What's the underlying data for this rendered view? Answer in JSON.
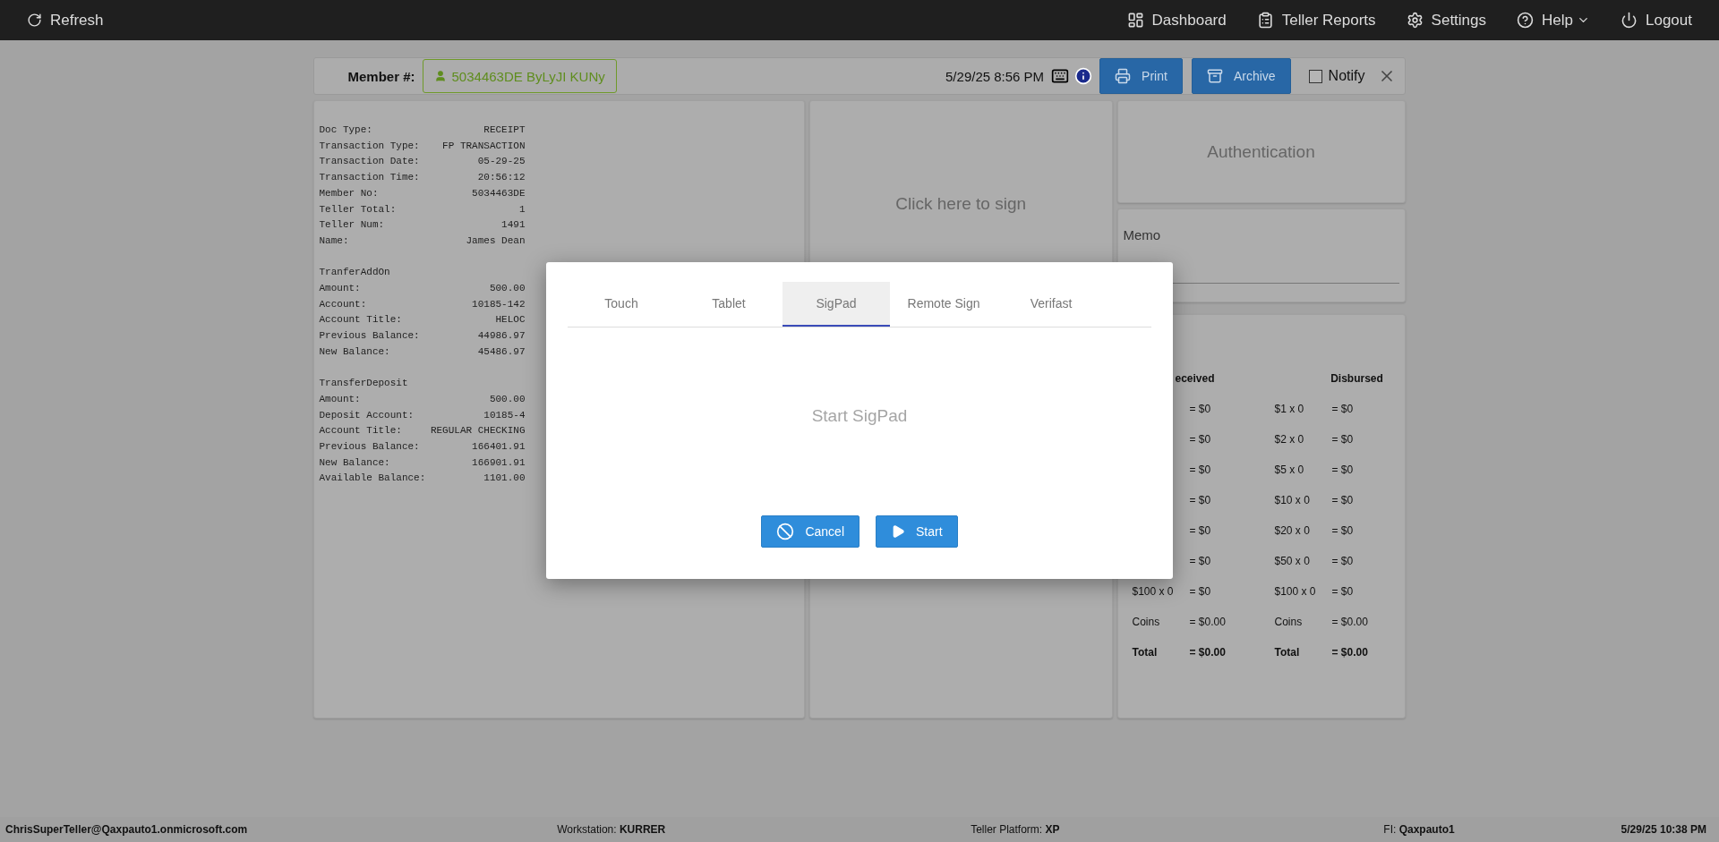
{
  "nav": {
    "left": [
      "Refresh"
    ],
    "right": [
      {
        "label": "Dashboard",
        "dropdown": false
      },
      {
        "label": "Teller Reports",
        "dropdown": false
      },
      {
        "label": "Settings",
        "dropdown": false
      },
      {
        "label": "Help",
        "dropdown": true
      },
      {
        "label": "Logout",
        "dropdown": false
      }
    ]
  },
  "header": {
    "member_label": "Member #:",
    "member": "5034463DE ByLyJI KUNy",
    "datetime": "5/29/25 8:56 PM",
    "buttons": [
      "Print",
      "Archive"
    ],
    "notify": {
      "label": "Notify",
      "checked": false
    }
  },
  "receipt": {
    "sections": [
      {
        "lines": [
          {
            "label": "Doc Type:",
            "value": "RECEIPT"
          },
          {
            "label": "Transaction Type:",
            "value": "FP TRANSACTION"
          },
          {
            "label": "Transaction Date:",
            "value": "05-29-25"
          },
          {
            "label": "Transaction Time:",
            "value": "20:56:12"
          },
          {
            "label": "Member No:",
            "value": "5034463DE"
          },
          {
            "label": "Teller Total:",
            "value": "1"
          },
          {
            "label": "Teller Num:",
            "value": "1491"
          },
          {
            "label": "Name:",
            "value": "James Dean"
          }
        ]
      },
      {
        "title": "TranferAddOn",
        "lines": [
          {
            "label": "Amount:",
            "value": "500.00"
          },
          {
            "label": "Account:",
            "value": "10185-142"
          },
          {
            "label": "Account Title:",
            "value": "HELOC"
          },
          {
            "label": "Previous Balance:",
            "value": "44986.97"
          },
          {
            "label": "New Balance:",
            "value": "45486.97"
          }
        ]
      },
      {
        "title": "TransferDeposit",
        "lines": [
          {
            "label": "Amount:",
            "value": "500.00"
          },
          {
            "label": "Deposit Account:",
            "value": "10185-4"
          },
          {
            "label": "Account Title:",
            "value": "REGULAR CHECKING"
          },
          {
            "label": "Previous Balance:",
            "value": "166401.91"
          },
          {
            "label": "New Balance:",
            "value": "166901.91"
          },
          {
            "label": "Available Balance:",
            "value": "1101.00"
          }
        ]
      }
    ]
  },
  "signature": {
    "prompt": "Click here to sign"
  },
  "authentication": {
    "title": "Authentication"
  },
  "memo": {
    "label": "Memo"
  },
  "cash": {
    "received": {
      "heading": "eceived",
      "rows": [
        {
          "kind": "line",
          "amount": "= $0"
        },
        {
          "kind": "line",
          "amount": "= $0"
        },
        {
          "kind": "line",
          "amount": "= $0"
        },
        {
          "kind": "line",
          "amount": "= $0"
        },
        {
          "kind": "line",
          "amount": "= $0"
        },
        {
          "kind": "line",
          "amount": "= $0"
        },
        {
          "kind": "line",
          "label": "$100 x 0",
          "amount": "= $0"
        },
        {
          "kind": "line",
          "label": "Coins",
          "amount": "= $0.00"
        },
        {
          "kind": "total",
          "label": "Total",
          "amount": "= $0.00"
        }
      ]
    },
    "disbursed": {
      "heading": "Disbursed",
      "rows": [
        {
          "kind": "line",
          "label": "$1 x 0",
          "amount": "= $0"
        },
        {
          "kind": "line",
          "label": "$2 x 0",
          "amount": "= $0"
        },
        {
          "kind": "line",
          "label": "$5 x 0",
          "amount": "= $0"
        },
        {
          "kind": "line",
          "label": "$10 x 0",
          "amount": "= $0"
        },
        {
          "kind": "line",
          "label": "$20 x 0",
          "amount": "= $0"
        },
        {
          "kind": "line",
          "label": "$50 x 0",
          "amount": "= $0"
        },
        {
          "kind": "line",
          "label": "$100 x 0",
          "amount": "= $0"
        },
        {
          "kind": "line",
          "label": "Coins",
          "amount": "= $0.00"
        },
        {
          "kind": "total",
          "label": "Total",
          "amount": "= $0.00"
        }
      ]
    }
  },
  "dialog": {
    "tabs": [
      {
        "label": "Touch",
        "selected": false
      },
      {
        "label": "Tablet",
        "selected": false
      },
      {
        "label": "SigPad",
        "selected": true
      },
      {
        "label": "Remote Sign",
        "selected": false
      },
      {
        "label": "Verifast",
        "selected": false
      }
    ],
    "message": "Start SigPad",
    "buttons": [
      "Cancel",
      "Start"
    ]
  },
  "status_bar": [
    {
      "value": "ChrisSuperTeller@Qaxpauto1.onmicrosoft.com"
    },
    {
      "label": "Workstation:",
      "value": "KURRER"
    },
    {
      "label": "Teller Platform:",
      "value": "XP"
    },
    {
      "label": "FI:",
      "value": "Qaxpauto1"
    },
    {
      "value": "5/29/25 10:38 PM"
    }
  ]
}
